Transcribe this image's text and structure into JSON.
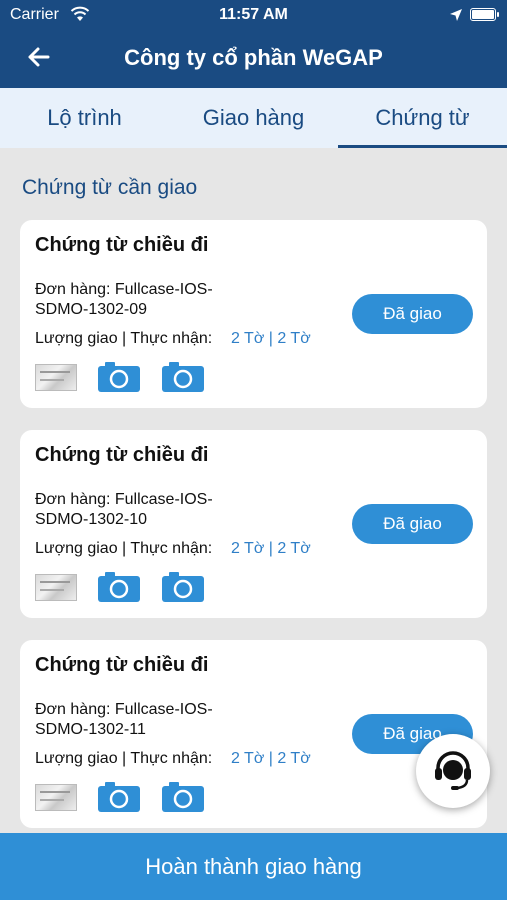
{
  "status_bar": {
    "carrier": "Carrier",
    "time": "11:57 AM"
  },
  "header": {
    "title": "Công ty cổ phần WeGAP"
  },
  "tabs": [
    {
      "label": "Lộ trình",
      "active": false
    },
    {
      "label": "Giao hàng",
      "active": false
    },
    {
      "label": "Chứng từ",
      "active": true
    }
  ],
  "section": {
    "title": "Chứng từ cần giao"
  },
  "cards": [
    {
      "title": "Chứng từ chiều đi",
      "order": "Đơn hàng: Fullcase-IOS-SDMO-1302-09",
      "qty_label": "Lượng giao | Thực nhận:",
      "qty_value": "2 Tờ | 2 Tờ",
      "button": "Đã giao"
    },
    {
      "title": "Chứng từ chiều đi",
      "order": "Đơn hàng: Fullcase-IOS-SDMO-1302-10",
      "qty_label": "Lượng giao | Thực nhận:",
      "qty_value": "2 Tờ | 2 Tờ",
      "button": "Đã giao"
    },
    {
      "title": "Chứng từ chiều đi",
      "order": "Đơn hàng: Fullcase-IOS-SDMO-1302-11",
      "qty_label": "Lượng giao | Thực nhận:",
      "qty_value": "2 Tờ | 2 Tờ",
      "button": "Đã giao"
    }
  ],
  "footer": {
    "button": "Hoàn thành giao hàng"
  },
  "icons": {
    "back": "arrow-left-icon",
    "camera": "camera-icon",
    "support": "headset-icon",
    "wifi": "wifi-icon",
    "location": "location-arrow-icon",
    "battery": "battery-icon"
  },
  "colors": {
    "header": "#1a4b82",
    "accent": "#2f8fd6",
    "tab_bg": "#e8f1fb",
    "background": "#e6e6e6"
  }
}
